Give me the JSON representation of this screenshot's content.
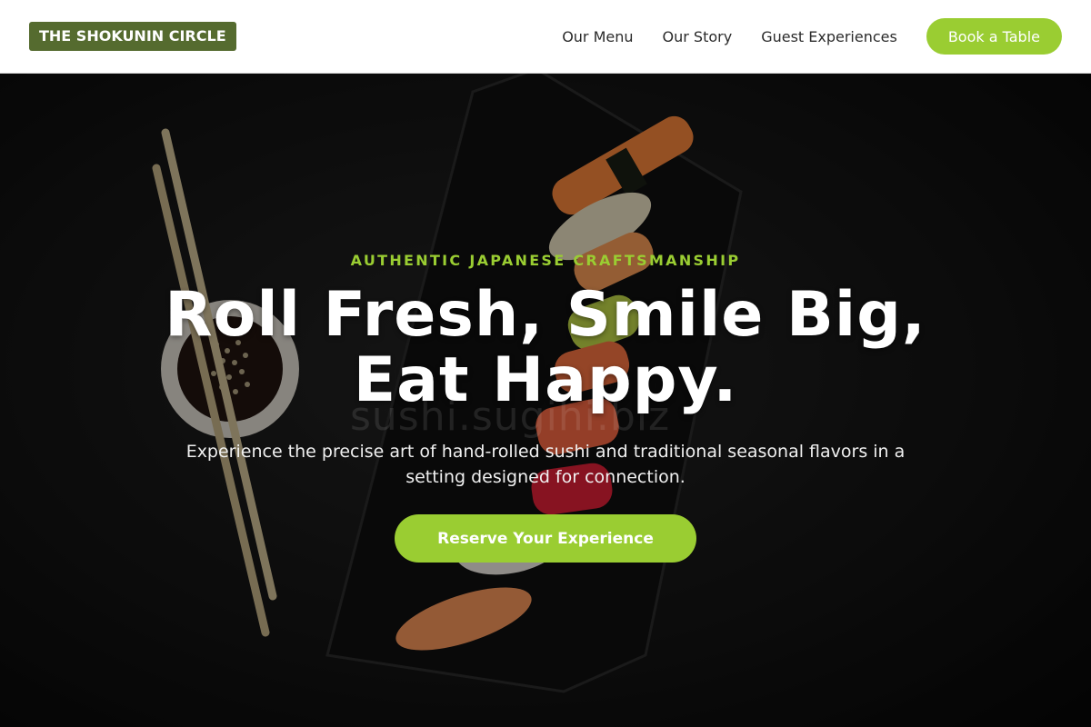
{
  "header": {
    "logo": "THE SHOKUNIN CIRCLE",
    "nav": [
      "Our Menu",
      "Our Story",
      "Guest Experiences"
    ],
    "book_button": "Book a Table"
  },
  "hero": {
    "eyebrow": "AUTHENTIC JAPANESE CRAFTSMANSHIP",
    "headline_line1": "Roll Fresh, Smile Big,",
    "headline_line2": "Eat Happy.",
    "subtitle_line1": "Experience the precise art of hand-rolled sushi and traditional seasonal flavors in a",
    "subtitle_line2": "setting designed for connection.",
    "cta_button": "Reserve Your Experience",
    "watermark": "sushi.sugihi.biz",
    "image": "sushi-platter-photo"
  },
  "colors": {
    "brand_green": "#9acd32",
    "logo_olive": "#556b2f",
    "header_bg": "#ffffff",
    "hero_bg": "#151515"
  }
}
